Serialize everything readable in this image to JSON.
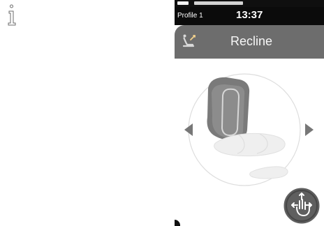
{
  "status": {
    "profile": "Profile 1",
    "time": "13:37"
  },
  "screen": {
    "title": "Recline"
  },
  "icons": {
    "info": "info-icon",
    "seat_function": "seat-recline-function-icon",
    "left": "left-arrow-icon",
    "right": "right-arrow-icon",
    "gesture": "multi-direction-gesture-icon"
  },
  "colors": {
    "status_bar": "#0b0b0b",
    "title_bar": "#6d6d6d",
    "seat_back": "#7a7a7a",
    "seat_back_highlight": "#d7d7d7",
    "seat_cushion": "#efefef",
    "arrow": "#777777",
    "gesture_button": "#5f5f5f"
  }
}
